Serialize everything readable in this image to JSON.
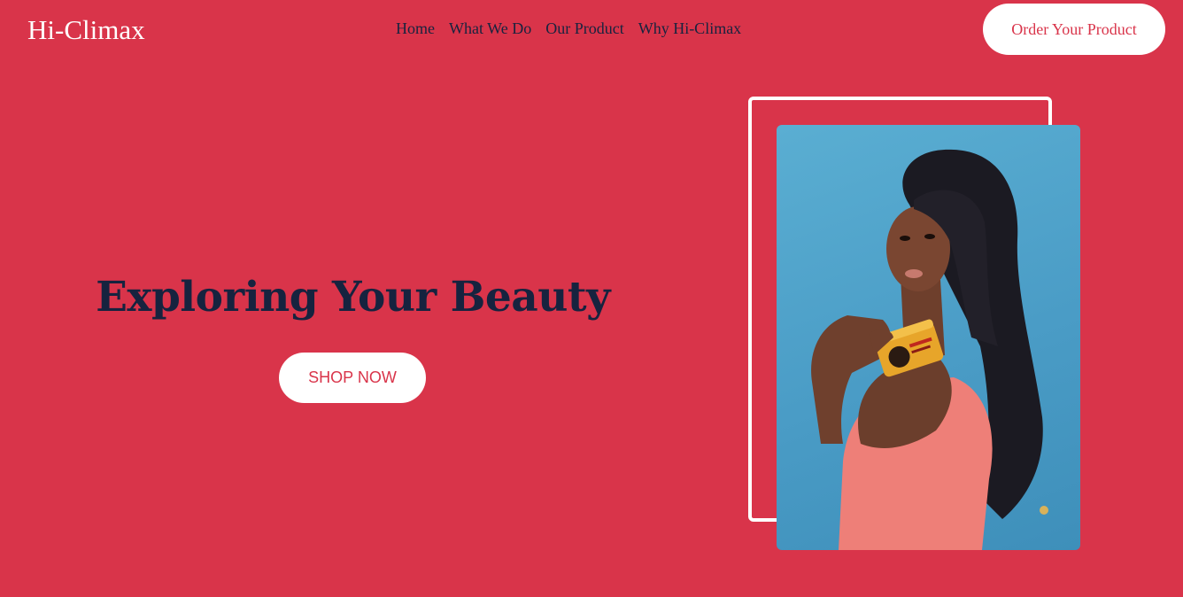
{
  "header": {
    "logo": "Hi-Climax",
    "nav": [
      "Home",
      "What We Do",
      "Our Product",
      "Why Hi-Climax"
    ],
    "order_button": "Order Your Product"
  },
  "hero": {
    "title": "Exploring Your Beauty",
    "shop_button": "SHOP NOW"
  },
  "colors": {
    "background": "#d9344a",
    "text_dark": "#16233f",
    "button_bg": "#ffffff",
    "photo_bg": "#4a9cc6"
  }
}
